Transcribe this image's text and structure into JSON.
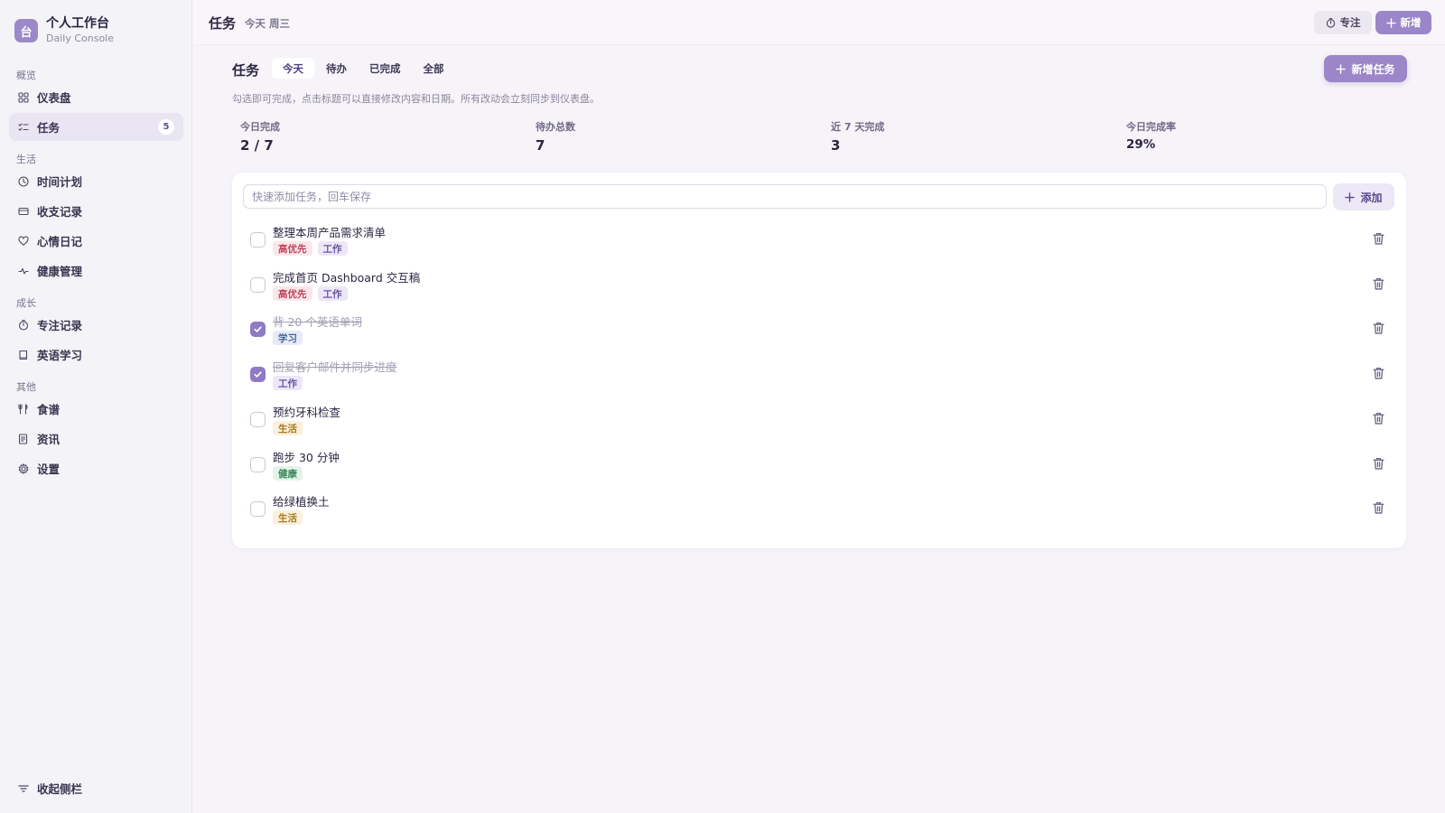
{
  "app": {
    "logo_char": "台",
    "title": "个人工作台",
    "subtitle": "Daily Console"
  },
  "sidebar": {
    "groups": [
      {
        "label": "概览",
        "items": [
          {
            "label": "仪表盘",
            "icon": "dashboard-icon"
          },
          {
            "label": "任务",
            "icon": "tasks-icon",
            "badge": "5",
            "active": true
          }
        ]
      },
      {
        "label": "生活",
        "items": [
          {
            "label": "时间计划",
            "icon": "clock-icon"
          },
          {
            "label": "收支记录",
            "icon": "wallet-icon"
          },
          {
            "label": "心情日记",
            "icon": "heart-icon"
          },
          {
            "label": "健康管理",
            "icon": "pulse-icon"
          }
        ]
      },
      {
        "label": "成长",
        "items": [
          {
            "label": "专注记录",
            "icon": "timer-icon"
          },
          {
            "label": "英语学习",
            "icon": "book-icon"
          }
        ]
      },
      {
        "label": "其他",
        "items": [
          {
            "label": "食谱",
            "icon": "utensils-icon"
          },
          {
            "label": "资讯",
            "icon": "news-icon"
          },
          {
            "label": "设置",
            "icon": "gear-icon"
          }
        ]
      }
    ],
    "collapse_label": "收起侧栏"
  },
  "topbar": {
    "title": "任务",
    "date": "今天 周三",
    "focus_label": "专注",
    "new_label": "新增"
  },
  "main": {
    "title": "任务",
    "tabs": [
      {
        "label": "今天",
        "active": true
      },
      {
        "label": "待办"
      },
      {
        "label": "已完成"
      },
      {
        "label": "全部"
      }
    ],
    "add_task_label": "新增任务",
    "hint": "勾选即可完成，点击标题可以直接修改内容和日期。所有改动会立刻同步到仪表盘。",
    "stats": [
      {
        "label": "今日完成",
        "value": "2 / 7"
      },
      {
        "label": "待办总数",
        "value": "7"
      },
      {
        "label": "近 7 天完成",
        "value": "3"
      },
      {
        "label": "今日完成率",
        "value": "29%"
      }
    ],
    "quick_add": {
      "placeholder": "快速添加任务，回车保存",
      "value": "",
      "button_label": "添加"
    },
    "tasks": [
      {
        "title": "整理本周产品需求清单",
        "done": false,
        "tags": [
          "高优先",
          "工作"
        ]
      },
      {
        "title": "完成首页 Dashboard 交互稿",
        "done": false,
        "tags": [
          "高优先",
          "工作"
        ]
      },
      {
        "title": "背 20 个英语单词",
        "done": true,
        "tags": [
          "学习"
        ]
      },
      {
        "title": "回复客户邮件并同步进度",
        "done": true,
        "tags": [
          "工作"
        ]
      },
      {
        "title": "预约牙科检查",
        "done": false,
        "tags": [
          "生活"
        ]
      },
      {
        "title": "跑步 30 分钟",
        "done": false,
        "tags": [
          "健康"
        ]
      },
      {
        "title": "给绿植换土",
        "done": false,
        "tags": [
          "生活"
        ]
      }
    ],
    "tag_colors": {
      "高优先": {
        "bg": "#fbe6ea",
        "fg": "#c0455c"
      },
      "工作": {
        "bg": "#ece7f6",
        "fg": "#6a55a6"
      },
      "学习": {
        "bg": "#e6ecf7",
        "fg": "#4a6296"
      },
      "生活": {
        "bg": "#faf0dc",
        "fg": "#a77a1e"
      },
      "健康": {
        "bg": "#e3f3ea",
        "fg": "#3d8a5c"
      }
    }
  }
}
